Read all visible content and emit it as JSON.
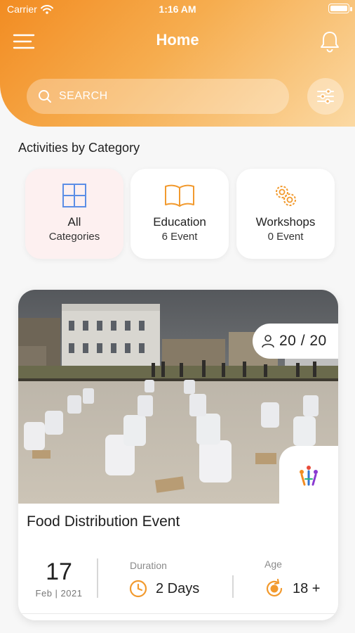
{
  "status_bar": {
    "carrier": "Carrier",
    "time": "1:16 AM"
  },
  "header": {
    "title": "Home"
  },
  "search": {
    "placeholder": "SEARCH"
  },
  "categories_section": {
    "title": "Activities by Category",
    "items": [
      {
        "name": "All",
        "sub": "Categories",
        "icon": "grid-icon",
        "selected": true
      },
      {
        "name": "Education",
        "sub": "6 Event",
        "icon": "book-icon",
        "selected": false
      },
      {
        "name": "Workshops",
        "sub": "0 Event",
        "icon": "gears-icon",
        "selected": false
      }
    ]
  },
  "event": {
    "capacity": "20 / 20",
    "title": "Food Distribution Event",
    "date_day": "17",
    "date_month_year": "Feb | 2021",
    "duration_label": "Duration",
    "duration_value": "2 Days",
    "age_label": "Age",
    "age_value": "18 +"
  },
  "colors": {
    "accent": "#f28c22",
    "icon_blue": "#5b8ee6",
    "icon_orange": "#f29a2e"
  }
}
